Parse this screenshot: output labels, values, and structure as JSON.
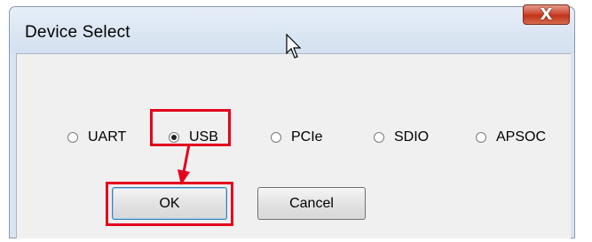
{
  "window": {
    "title": "Device Select",
    "close_glyph": "X"
  },
  "interface_options": [
    {
      "label": "UART",
      "checked": false
    },
    {
      "label": "USB",
      "checked": true
    },
    {
      "label": "PCIe",
      "checked": false
    },
    {
      "label": "SDIO",
      "checked": false
    },
    {
      "label": "APSOC",
      "checked": false
    }
  ],
  "buttons": {
    "ok_label": "OK",
    "cancel_label": "Cancel"
  },
  "annotation_color": "#e4001b",
  "icons": [
    "close-icon",
    "mouse-cursor-icon",
    "annotation-arrow-icon"
  ]
}
